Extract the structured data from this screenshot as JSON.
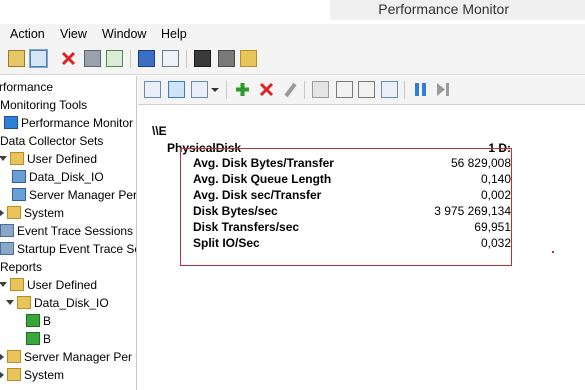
{
  "window": {
    "title": "Performance Monitor"
  },
  "menu": [
    "Action",
    "View",
    "Window",
    "Help"
  ],
  "tree": [
    {
      "label": "rformance",
      "indent": 0,
      "icon": "none"
    },
    {
      "label": "Monitoring Tools",
      "indent": 0,
      "icon": "none"
    },
    {
      "label": "Performance Monitor",
      "indent": 1,
      "icon": "perf-icon"
    },
    {
      "label": "Data Collector Sets",
      "indent": 0,
      "icon": "none"
    },
    {
      "label": "User Defined",
      "indent": 1,
      "icon": "folder-icon",
      "arrow": "open"
    },
    {
      "label": "Data_Disk_IO",
      "indent": 2,
      "icon": "collector-set-icon"
    },
    {
      "label": "Server Manager Per",
      "indent": 2,
      "icon": "collector-set-icon"
    },
    {
      "label": "System",
      "indent": 1,
      "icon": "folder-icon",
      "arrow": "closed"
    },
    {
      "label": "Event Trace Sessions",
      "indent": 1,
      "icon": "trace-icon"
    },
    {
      "label": "Startup Event Trace Ses",
      "indent": 1,
      "icon": "trace-icon"
    },
    {
      "label": "Reports",
      "indent": 0,
      "icon": "none"
    },
    {
      "label": "User Defined",
      "indent": 1,
      "icon": "folder-icon",
      "arrow": "open"
    },
    {
      "label": "Data_Disk_IO",
      "indent": 2,
      "icon": "folder-icon",
      "arrow": "open"
    },
    {
      "label": "B",
      "indent": 3,
      "icon": "report-icon"
    },
    {
      "label": "B",
      "indent": 3,
      "icon": "report-icon"
    },
    {
      "label": "Server Manager Per",
      "indent": 1,
      "icon": "folder-icon",
      "arrow": "closed"
    },
    {
      "label": "System",
      "indent": 1,
      "icon": "folder-icon",
      "arrow": "closed"
    }
  ],
  "report": {
    "computer": "\\\\E",
    "object": "PhysicalDisk",
    "instance": "1 D:",
    "counters": [
      {
        "name": "Avg. Disk Bytes/Transfer",
        "value": "56 829,008"
      },
      {
        "name": "Avg. Disk Queue Length",
        "value": "0,140"
      },
      {
        "name": "Avg. Disk sec/Transfer",
        "value": "0,002"
      },
      {
        "name": "Disk Bytes/sec",
        "value": "3 975 269,134"
      },
      {
        "name": "Disk Transfers/sec",
        "value": "69,951"
      },
      {
        "name": "Split IO/Sec",
        "value": "0,032"
      }
    ]
  },
  "colors": {
    "highlight_box": "#c03030",
    "accent": "#2f7fd6"
  }
}
